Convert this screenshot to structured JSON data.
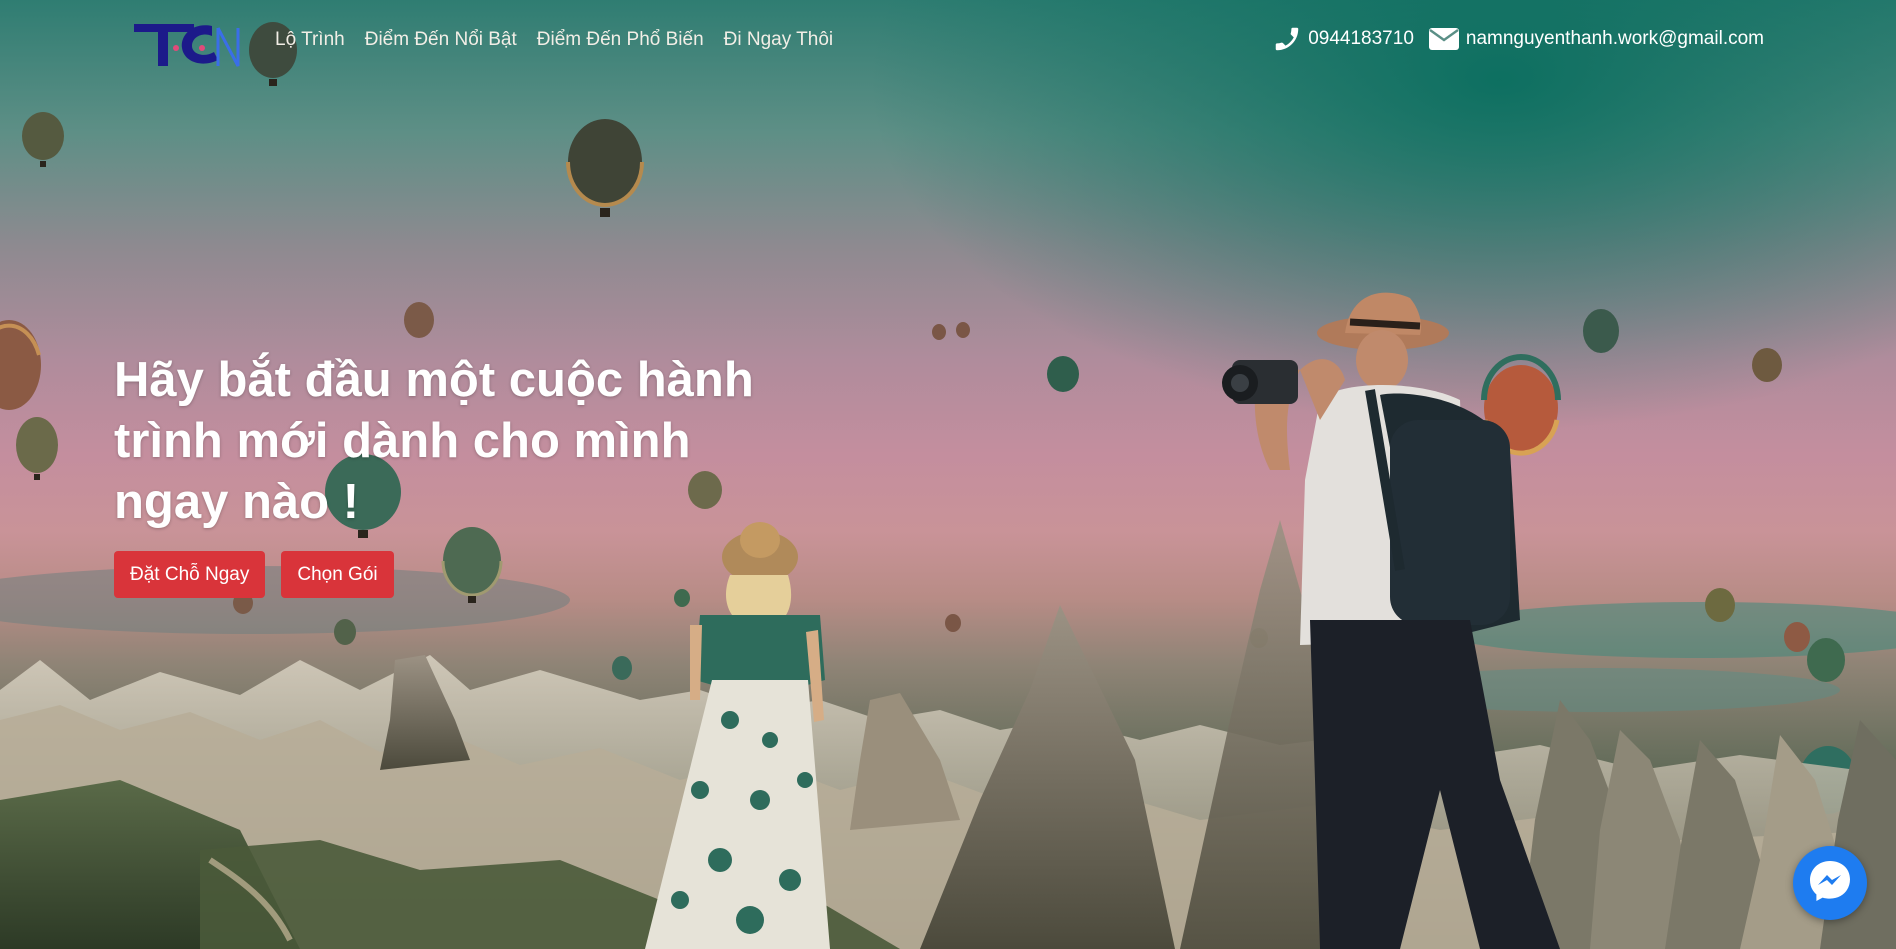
{
  "nav": {
    "logo_icon": "brand-logo-icon",
    "links": [
      {
        "label": "Lộ Trình"
      },
      {
        "label": "Điểm Đến Nổi Bật"
      },
      {
        "label": "Điểm Đến Phổ Biến"
      },
      {
        "label": "Đi Ngay Thôi"
      }
    ],
    "phone": "0944183710",
    "phone_icon": "phone-icon",
    "email": "namnguyenthanh.work@gmail.com",
    "email_icon": "envelope-icon"
  },
  "hero": {
    "title_lines": [
      "Hãy bắt đầu một cuộc hành",
      "trình mới dành cho mình",
      "ngay nào !"
    ],
    "buttons": {
      "book_label": "Đặt Chỗ Ngay",
      "package_label": "Chọn Gói"
    },
    "background_image": "hot-air-balloons-couple-photo"
  },
  "messenger": {
    "icon": "messenger-icon"
  },
  "colors": {
    "button_red": "#d9343a",
    "messenger_blue": "#1e7cf0",
    "sky_teal": "#0a6e5f",
    "nav_text": "#f2eee6"
  }
}
